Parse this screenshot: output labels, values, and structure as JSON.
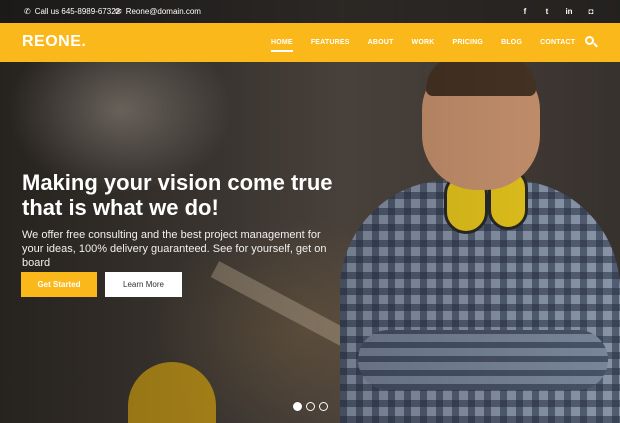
{
  "topbar": {
    "phone_icon": "phone-icon",
    "phone": "Call us 645-8989-67322",
    "email_icon": "envelope-icon",
    "email": "Reone@domain.com",
    "social": [
      {
        "icon": "facebook-icon",
        "glyph": "f"
      },
      {
        "icon": "twitter-icon",
        "glyph": "t"
      },
      {
        "icon": "linkedin-icon",
        "glyph": "in"
      },
      {
        "icon": "instagram-icon",
        "glyph": "◘"
      }
    ]
  },
  "navbar": {
    "logo": "REONE.",
    "items": [
      "HOME",
      "FEATURES",
      "ABOUT",
      "WORK",
      "PRICING",
      "BLOG",
      "CONTACT"
    ],
    "active": "HOME",
    "search_icon": "search-icon"
  },
  "hero": {
    "headline_line1": "Making your vision come true",
    "headline_line2": "that is what we do!",
    "subline_line1": "We offer free consulting and the best project management for",
    "subline_line2": "your ideas, 100% delivery guaranteed. See for yourself, get on board",
    "primary_button": "Get Started",
    "secondary_button": "Learn More"
  },
  "slider": {
    "slides": 3,
    "active_index": 0
  },
  "colors": {
    "accent": "#fbb81b",
    "white": "#ffffff"
  }
}
